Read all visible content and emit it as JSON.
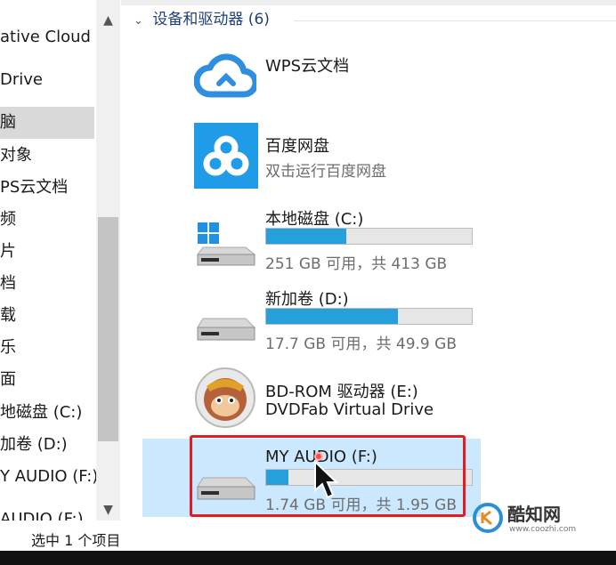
{
  "sidebar": {
    "items": [
      {
        "label": "ative Cloud Fi"
      },
      {
        "label": "Drive"
      },
      {
        "label": "脑"
      },
      {
        "label": "对象"
      },
      {
        "label": "PS云文档"
      },
      {
        "label": "频"
      },
      {
        "label": "片"
      },
      {
        "label": "档"
      },
      {
        "label": "载"
      },
      {
        "label": "乐"
      },
      {
        "label": "面"
      },
      {
        "label": "地磁盘 (C:)"
      },
      {
        "label": "加卷 (D:)"
      },
      {
        "label": "Y AUDIO (F:)"
      },
      {
        "label": "AUDIO (F:)"
      }
    ],
    "scroll_up": "▲",
    "scroll_down": "▼"
  },
  "group": {
    "title": "设备和驱动器 (6)",
    "chevron": "⌄"
  },
  "drives": [
    {
      "name": "WPS云文档",
      "sub": "",
      "icon": "wps-cloud-icon"
    },
    {
      "name": "百度网盘",
      "sub": "双击运行百度网盘",
      "icon": "baidu-netdisk-icon"
    },
    {
      "name": "本地磁盘 (C:)",
      "sub": "251 GB 可用，共 413 GB",
      "used_fraction": 0.39,
      "icon": "windows-drive-icon"
    },
    {
      "name": "新加卷 (D:)",
      "sub": "17.7 GB 可用，共 49.9 GB",
      "used_fraction": 0.64,
      "icon": "hard-drive-icon"
    },
    {
      "name": "BD-ROM 驱动器 (E:)",
      "sub": "DVDFab Virtual Drive",
      "icon": "dvdfab-icon"
    },
    {
      "name": "MY AUDIO (F:)",
      "sub": "1.74 GB 可用，共 1.95 GB",
      "used_fraction": 0.11,
      "icon": "usb-drive-icon"
    }
  ],
  "status": {
    "selection": "选中 1 个项目"
  },
  "watermark": {
    "text": "酷知网",
    "url": "www.coozhi.com"
  },
  "colors": {
    "accent": "#26a0da",
    "selection": "#cce8ff",
    "highlight": "#e31b23"
  }
}
